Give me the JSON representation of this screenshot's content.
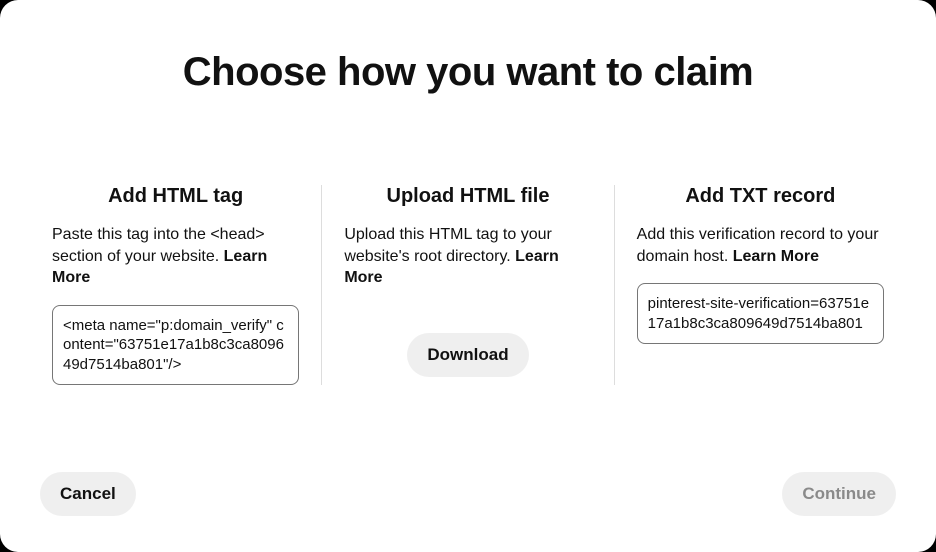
{
  "title": "Choose how you want to claim",
  "options": {
    "html_tag": {
      "heading": "Add HTML tag",
      "description_pre": "Paste this tag into the <head> section of your website. ",
      "learn_more": "Learn More",
      "code": "<meta name=\"p:domain_verify\" content=\"63751e17a1b8c3ca809649d7514ba801\"/>"
    },
    "upload_file": {
      "heading": "Upload HTML file",
      "description_pre": "Upload this HTML tag to your website's root directory. ",
      "learn_more": "Learn More",
      "download_label": "Download"
    },
    "txt_record": {
      "heading": "Add TXT record",
      "description_pre": "Add this verification record to your domain host. ",
      "learn_more": "Learn More",
      "code": "pinterest-site-verification=63751e17a1b8c3ca809649d7514ba801"
    }
  },
  "footer": {
    "cancel": "Cancel",
    "continue": "Continue"
  }
}
